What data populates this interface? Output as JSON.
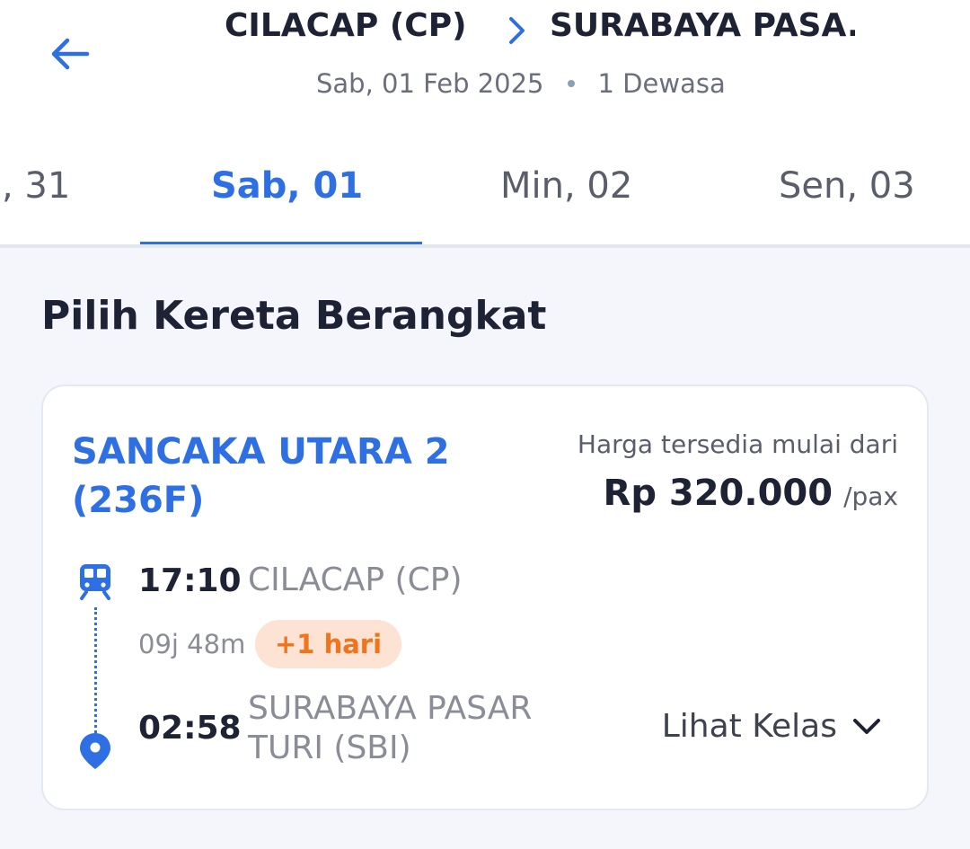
{
  "header": {
    "from": "CILACAP (CP)",
    "to": "SURABAYA PASA...",
    "date": "Sab, 01 Feb 2025",
    "passengers": "1 Dewasa"
  },
  "tabs": [
    {
      "label": ", 31",
      "active": false
    },
    {
      "label": "Sab, 01",
      "active": true
    },
    {
      "label": "Min, 02",
      "active": false
    },
    {
      "label": "Sen, 03",
      "active": false
    }
  ],
  "section_title": "Pilih Kereta Berangkat",
  "train": {
    "name": "SANCAKA UTARA 2 (236F)",
    "price_label": "Harga tersedia mulai dari",
    "price": "Rp 320.000",
    "price_unit": "/pax",
    "departure_time": "17:10",
    "departure_station": "CILACAP (CP)",
    "duration": "09j 48m",
    "day_badge": "+1 hari",
    "arrival_time": "02:58",
    "arrival_station": "SURABAYA PASAR TURI (SBI)",
    "see_class_label": "Lihat Kelas"
  },
  "colors": {
    "accent": "#2f6fe4",
    "badge_bg": "#fde3d3",
    "badge_text": "#f0741c"
  },
  "icons": [
    "back-arrow-icon",
    "chevron-right-icon",
    "train-icon",
    "location-pin-icon",
    "chevron-down-icon"
  ]
}
